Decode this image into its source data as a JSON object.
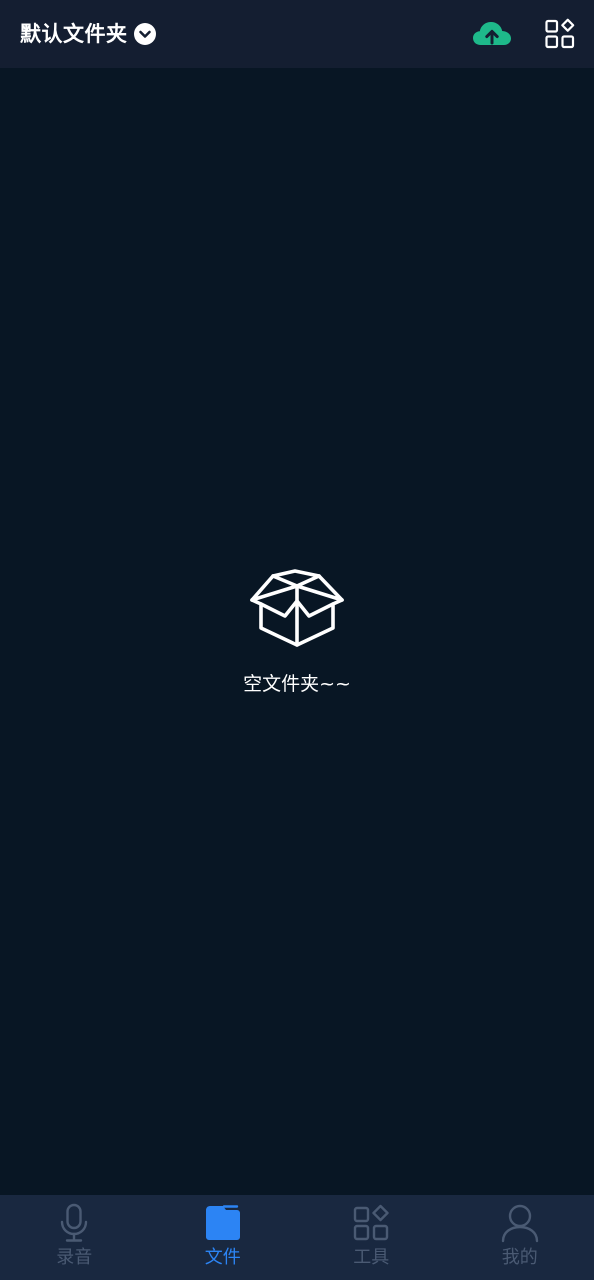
{
  "header": {
    "folder_title": "默认文件夹"
  },
  "icons": {
    "folder_dropdown": "chevron-down-circle-icon",
    "upload": "cloud-upload-icon",
    "grid": "apps-grid-icon",
    "empty": "open-box-icon"
  },
  "empty_state": {
    "message": "空文件夹~~"
  },
  "tabbar": {
    "tabs": [
      {
        "label": "录音",
        "icon": "microphone-icon",
        "active": false
      },
      {
        "label": "文件",
        "icon": "folder-icon",
        "active": true
      },
      {
        "label": "工具",
        "icon": "tools-grid-icon",
        "active": false
      },
      {
        "label": "我的",
        "icon": "user-icon",
        "active": false
      }
    ]
  },
  "colors": {
    "background": "#081624",
    "header_bg": "#141e31",
    "tabbar_bg": "#192840",
    "accent_green": "#1eb98a",
    "accent_blue": "#2c84f4",
    "inactive": "#4a5a73"
  }
}
